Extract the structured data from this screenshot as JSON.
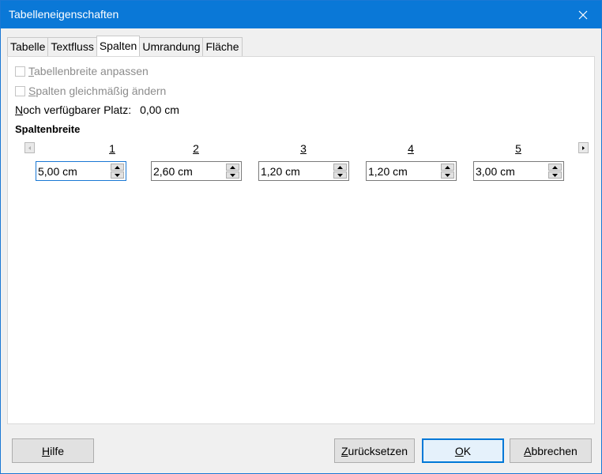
{
  "window": {
    "title": "Tabelleneigenschaften"
  },
  "tabs": [
    {
      "label": "Tabelle"
    },
    {
      "label": "Textfluss"
    },
    {
      "label": "Spalten",
      "active": true
    },
    {
      "label": "Umrandung"
    },
    {
      "label": "Fläche"
    }
  ],
  "options": {
    "adapt_width": {
      "label_u": "T",
      "label_rest": "abellenbreite anpassen"
    },
    "adjust_columns": {
      "label_u": "S",
      "label_rest": "palten gleichmäßig ändern"
    }
  },
  "space": {
    "label_u": "N",
    "label_rest": "och verfügbarer Platz:",
    "value": "0,00 cm"
  },
  "section": {
    "title": "Spaltenbreite"
  },
  "columns": [
    {
      "label": "1",
      "value": "5,00 cm"
    },
    {
      "label": "2",
      "value": "2,60 cm"
    },
    {
      "label": "3",
      "value": "1,20 cm"
    },
    {
      "label": "4",
      "value": "1,20 cm"
    },
    {
      "label": "5",
      "value": "3,00 cm"
    }
  ],
  "buttons": {
    "help": {
      "label_u": "H",
      "label_rest": "ilfe"
    },
    "reset": {
      "label_u": "Z",
      "label_rest": "urücksetzen"
    },
    "ok": {
      "label_u": "O",
      "label_rest": "K"
    },
    "cancel": {
      "label_u": "A",
      "label_rest": "bbrechen"
    }
  },
  "colors": {
    "titlebar": "#0a78d7",
    "accent": "#0078d7"
  }
}
